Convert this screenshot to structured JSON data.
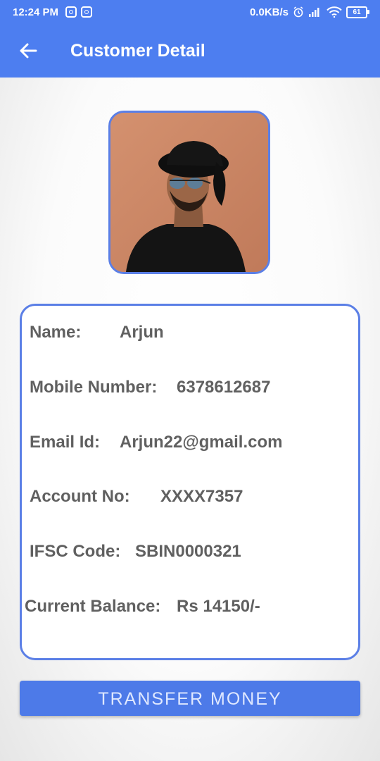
{
  "status_bar": {
    "time": "12:24 PM",
    "network_speed": "0.0KB/s",
    "battery": "61",
    "icons": [
      "instagram-icon",
      "instagram-icon",
      "alarm-icon",
      "signal-icon",
      "wifi-icon",
      "battery-icon"
    ]
  },
  "app_bar": {
    "title": "Customer Detail",
    "back_icon": "arrow-left-icon",
    "background_color": "#4d7ef0"
  },
  "customer": {
    "photo": "profile-photo",
    "name_label": "Name:",
    "name_value": "Arjun",
    "mobile_label": "Mobile Number:",
    "mobile_value": "6378612687",
    "email_label": "Email Id:",
    "email_value": "Arjun22@gmail.com",
    "account_label": "Account No:",
    "account_value": "XXXX7357",
    "ifsc_label": "IFSC Code:",
    "ifsc_value": "SBIN0000321",
    "balance_label": "Current Balance:",
    "balance_value": "Rs 14150/-"
  },
  "actions": {
    "transfer_label": "TRANSFER MONEY"
  },
  "colors": {
    "accent": "#4d7ef0",
    "border": "#5b7fe6",
    "text": "#606060"
  }
}
